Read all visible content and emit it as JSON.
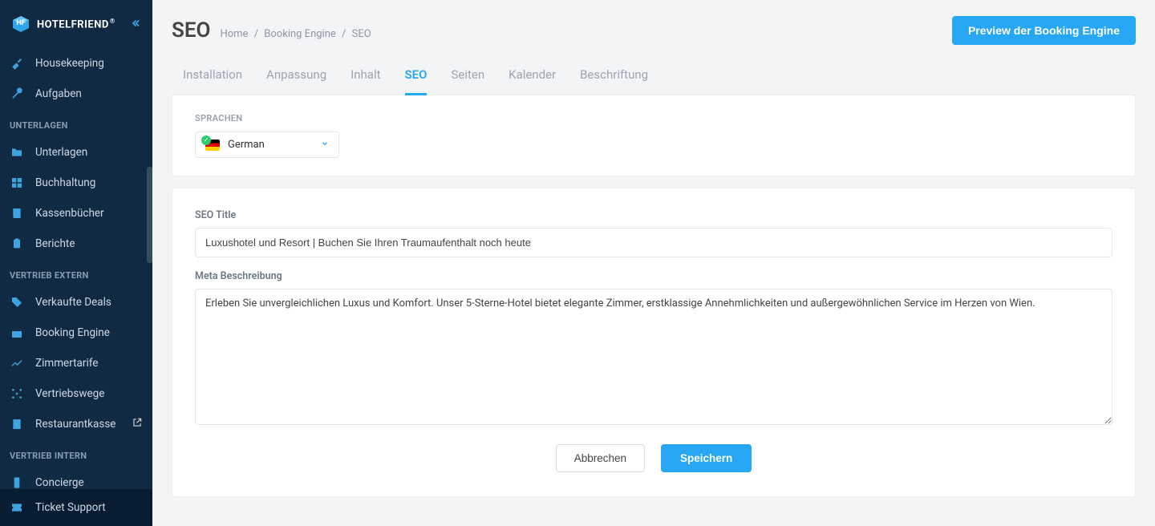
{
  "brand": {
    "name": "HOTELFRIEND"
  },
  "sidebar": {
    "items": [
      {
        "label": "Housekeeping",
        "icon": "broom-icon"
      },
      {
        "label": "Aufgaben",
        "icon": "wrench-icon"
      }
    ],
    "sections": [
      {
        "header": "UNTERLAGEN",
        "items": [
          {
            "label": "Unterlagen",
            "icon": "folder-icon"
          },
          {
            "label": "Buchhaltung",
            "icon": "grid-icon"
          },
          {
            "label": "Kassenbücher",
            "icon": "book-icon"
          },
          {
            "label": "Berichte",
            "icon": "clipboard-icon"
          }
        ]
      },
      {
        "header": "VERTRIEB EXTERN",
        "items": [
          {
            "label": "Verkaufte Deals",
            "icon": "tag-icon"
          },
          {
            "label": "Booking Engine",
            "icon": "calendar-check-icon"
          },
          {
            "label": "Zimmertarife",
            "icon": "chart-line-icon"
          },
          {
            "label": "Vertriebswege",
            "icon": "nodes-icon"
          },
          {
            "label": "Restaurantkasse",
            "icon": "receipt-icon",
            "external": true
          }
        ]
      },
      {
        "header": "VERTRIEB INTERN",
        "items": [
          {
            "label": "Concierge",
            "icon": "phone-icon"
          }
        ]
      }
    ],
    "footer": {
      "label": "Ticket Support",
      "icon": "ticket-icon"
    }
  },
  "header": {
    "title": "SEO",
    "breadcrumb": [
      "Home",
      "Booking Engine",
      "SEO"
    ],
    "preview_button": "Preview der Booking Engine"
  },
  "tabs": [
    {
      "label": "Installation",
      "active": false
    },
    {
      "label": "Anpassung",
      "active": false
    },
    {
      "label": "Inhalt",
      "active": false
    },
    {
      "label": "SEO",
      "active": true
    },
    {
      "label": "Seiten",
      "active": false
    },
    {
      "label": "Kalender",
      "active": false
    },
    {
      "label": "Beschriftung",
      "active": false
    }
  ],
  "lang": {
    "label": "SPRACHEN",
    "selected": "German"
  },
  "form": {
    "title_label": "SEO Title",
    "title_value": "Luxushotel und Resort | Buchen Sie Ihren Traumaufenthalt noch heute",
    "meta_label": "Meta Beschreibung",
    "meta_value": "Erleben Sie unvergleichlichen Luxus und Komfort. Unser 5-Sterne-Hotel bietet elegante Zimmer, erstklassige Annehmlichkeiten und außergewöhnlichen Service im Herzen von Wien."
  },
  "actions": {
    "cancel": "Abbrechen",
    "save": "Speichern"
  }
}
